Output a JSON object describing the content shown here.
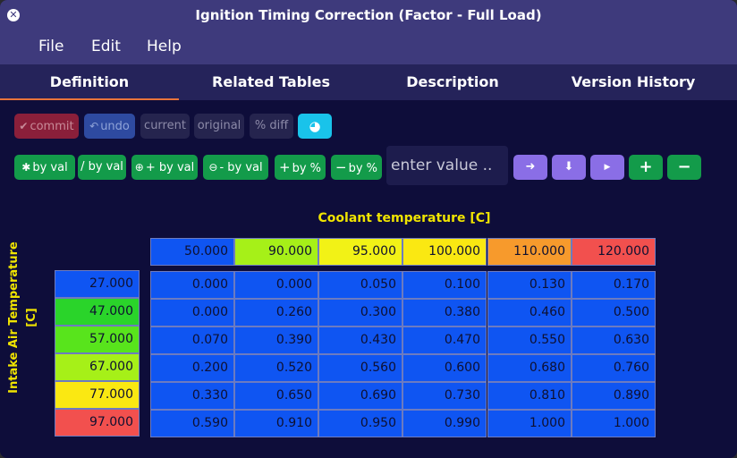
{
  "window": {
    "title": "Ignition Timing Correction (Factor - Full Load)"
  },
  "menu": [
    "File",
    "Edit",
    "Help"
  ],
  "tabs": [
    {
      "label": "Definition",
      "active": true
    },
    {
      "label": "Related Tables",
      "active": false
    },
    {
      "label": "Description",
      "active": false
    },
    {
      "label": "Version History",
      "active": false
    }
  ],
  "toolbar1": {
    "commit": "commit",
    "undo": "undo",
    "current": "current",
    "original": "original",
    "diff": "% diff"
  },
  "toolbar2": {
    "mul_by_val": "by val",
    "div_by_val": "/ by val",
    "add_by_val": "+ by val",
    "sub_by_val": "- by val",
    "add_by_pct": "by %",
    "sub_by_pct": "by %",
    "value_placeholder": "enter value .."
  },
  "table": {
    "x_axis_label": "Coolant temperature [C]",
    "y_axis_label_line1": "Intake Air Temperature",
    "y_axis_label_line2": "[C]",
    "x_headers": [
      "50.000",
      "90.000",
      "95.000",
      "100.000",
      "110.000",
      "120.000"
    ],
    "x_header_colors": [
      "#0f55f2",
      "#a6f018",
      "#f2f216",
      "#fae812",
      "#f79a2c",
      "#f2504e"
    ],
    "y_headers": [
      "27.000",
      "47.000",
      "57.000",
      "67.000",
      "77.000",
      "97.000"
    ],
    "y_header_colors": [
      "#0f55f2",
      "#2ad42a",
      "#58e41c",
      "#a6f018",
      "#fae812",
      "#f2504e"
    ],
    "rows": [
      [
        "0.000",
        "0.000",
        "0.050",
        "0.100",
        "0.130",
        "0.170"
      ],
      [
        "0.000",
        "0.260",
        "0.300",
        "0.380",
        "0.460",
        "0.500"
      ],
      [
        "0.070",
        "0.390",
        "0.430",
        "0.470",
        "0.550",
        "0.630"
      ],
      [
        "0.200",
        "0.520",
        "0.560",
        "0.600",
        "0.680",
        "0.760"
      ],
      [
        "0.330",
        "0.650",
        "0.690",
        "0.730",
        "0.810",
        "0.890"
      ],
      [
        "0.590",
        "0.910",
        "0.950",
        "0.990",
        "1.000",
        "1.000"
      ]
    ]
  }
}
